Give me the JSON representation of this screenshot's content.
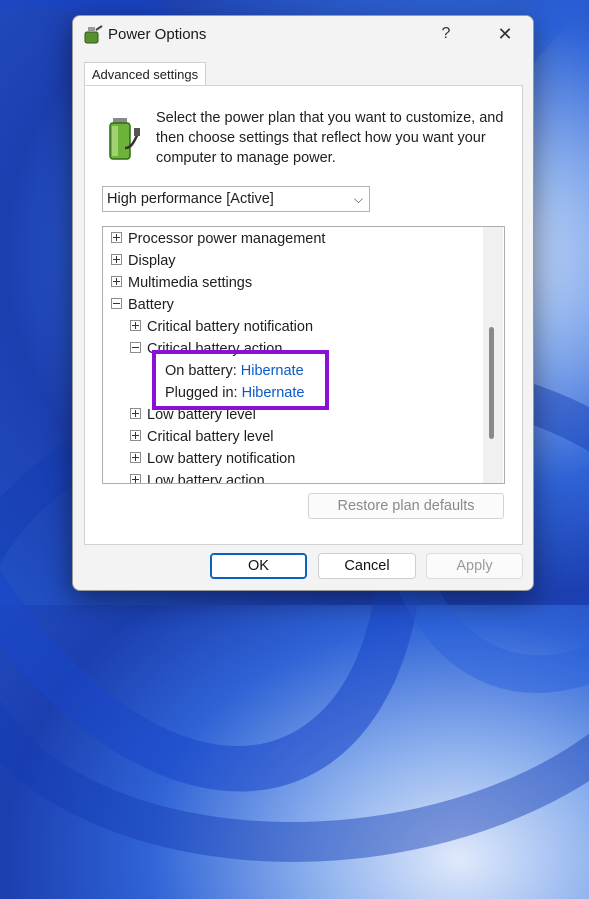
{
  "window": {
    "title": "Power Options",
    "help_glyph": "?",
    "close_glyph": "✕"
  },
  "tab": {
    "label": "Advanced settings"
  },
  "intro_text": "Select the power plan that you want to customize, and then choose settings that reflect how you want your computer to manage power.",
  "plan_select": {
    "value": "High performance [Active]",
    "chevron": "⌵"
  },
  "tree": {
    "items": [
      {
        "label": "Processor power management",
        "level": 0,
        "expanded": false
      },
      {
        "label": "Display",
        "level": 0,
        "expanded": false
      },
      {
        "label": "Multimedia settings",
        "level": 0,
        "expanded": false
      },
      {
        "label": "Battery",
        "level": 0,
        "expanded": true
      },
      {
        "label": "Critical battery notification",
        "level": 1,
        "expanded": false
      },
      {
        "label": "Critical battery action",
        "level": 1,
        "expanded": true
      },
      {
        "label": "On battery:",
        "value": "Hibernate",
        "level": 2
      },
      {
        "label": "Plugged in:",
        "value": "Hibernate",
        "level": 2
      },
      {
        "label": "Low battery level",
        "level": 1,
        "expanded": false
      },
      {
        "label": "Critical battery level",
        "level": 1,
        "expanded": false
      },
      {
        "label": "Low battery notification",
        "level": 1,
        "expanded": false
      },
      {
        "label": "Low battery action",
        "level": 1,
        "expanded": false
      }
    ]
  },
  "buttons": {
    "restore": "Restore plan defaults",
    "ok": "OK",
    "cancel": "Cancel",
    "apply": "Apply"
  },
  "colors": {
    "highlight_box": "#8a10d6",
    "setting_value": "#0a58ca",
    "desktop_blue": "#2f63d6"
  },
  "icons": [
    "power-options-icon",
    "battery-plug-icon",
    "chevron-down-icon",
    "expand-icon",
    "collapse-icon",
    "close-icon"
  ]
}
